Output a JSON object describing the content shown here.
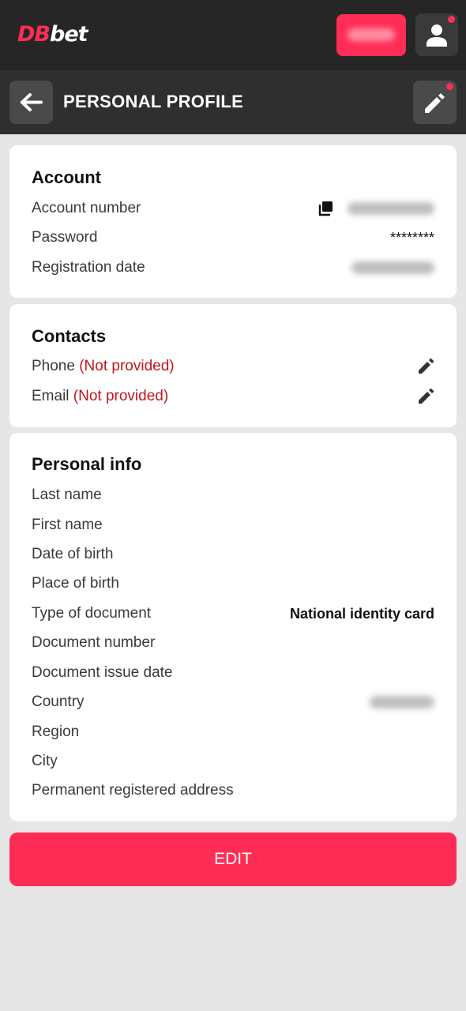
{
  "header": {
    "logo_db": "DB",
    "logo_bet": "bet"
  },
  "titlebar": {
    "title": "PERSONAL PROFILE"
  },
  "account": {
    "title": "Account",
    "account_number_label": "Account number",
    "password_label": "Password",
    "password_value": "********",
    "registration_date_label": "Registration date"
  },
  "contacts": {
    "title": "Contacts",
    "phone_label": "Phone",
    "phone_status": "(Not provided)",
    "email_label": "Email",
    "email_status": "(Not provided)"
  },
  "personal": {
    "title": "Personal info",
    "rows": [
      {
        "label": "Last name",
        "value": ""
      },
      {
        "label": "First name",
        "value": ""
      },
      {
        "label": "Date of birth",
        "value": ""
      },
      {
        "label": "Place of birth",
        "value": ""
      },
      {
        "label": "Type of document",
        "value": "National identity card"
      },
      {
        "label": "Document number",
        "value": ""
      },
      {
        "label": "Document issue date",
        "value": ""
      },
      {
        "label": "Country",
        "value": ""
      },
      {
        "label": "Region",
        "value": ""
      },
      {
        "label": "City",
        "value": ""
      },
      {
        "label": "Permanent registered address",
        "value": ""
      }
    ]
  },
  "actions": {
    "edit_label": "EDIT"
  },
  "colors": {
    "brand": "#ff2d55",
    "not_provided": "#c4151c",
    "topbar": "#262626",
    "titlebar": "#2f2f2f"
  }
}
